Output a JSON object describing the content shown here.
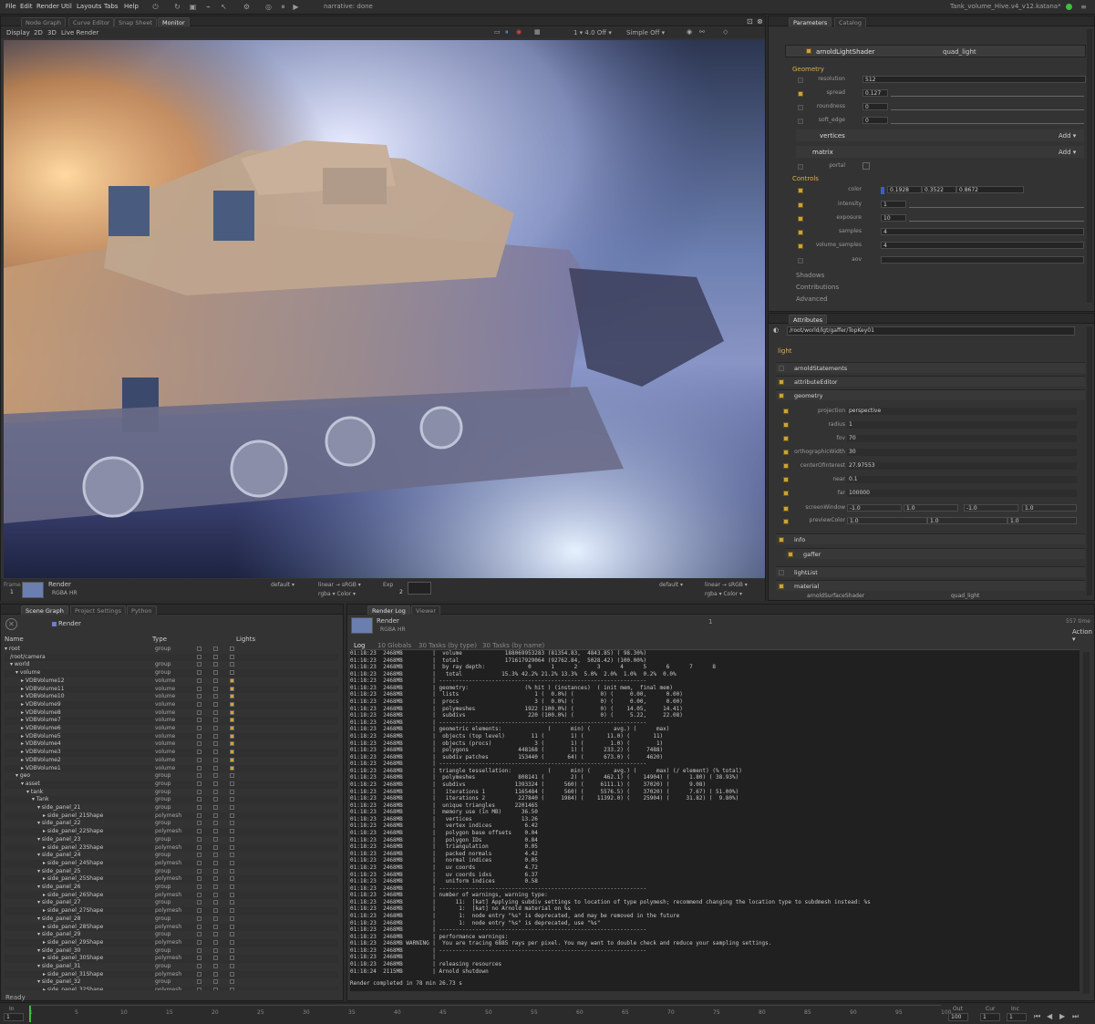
{
  "menu": [
    "File",
    "Edit",
    "Render",
    "Util",
    "Layouts",
    "Tabs",
    "Help"
  ],
  "toolbar": {
    "render_mode": "narrative: done"
  },
  "window_title": "Tank_volume_Hive.v4_v12.katana*",
  "viewer": {
    "tabs": [
      "Node Graph",
      "Curve Editor",
      "Snap Sheet",
      "Monitor"
    ],
    "active_tab": "Monitor",
    "menus": [
      "Display",
      "2D",
      "3D",
      "Live Render"
    ],
    "frame_label": "Frame",
    "frame_value": "1",
    "render_name": "Render",
    "render_sub": "RGBA HR",
    "default_l": "default ▾",
    "linear_srgb_l": "linear → sRGB ▾",
    "rgba_color_l": "rgba ▾ Color ▾",
    "default_r": "default ▾",
    "linear_srgb_r": "linear → sRGB ▾",
    "rgba_color_r": "rgba ▾ Color ▾",
    "fstop": "1 ▾ 4.0 Off ▾",
    "simple": "Simple Off ▾",
    "exposure_label": "Exp",
    "exposure_value": "2"
  },
  "params": {
    "tabs": [
      "Parameters",
      "Catalog"
    ],
    "node_name": "arnoldLightShader",
    "shader": "quad_light",
    "geometry_section": "Geometry",
    "resolution_label": "resolution",
    "resolution": "512",
    "spread_label": "spread",
    "spread": "0.127",
    "roundness_label": "roundness",
    "roundness": "0",
    "soft_edge_label": "soft_edge",
    "soft_edge": "0",
    "vertices": "vertices",
    "matrix": "matrix",
    "add_label": "Add ▾",
    "portal_label": "portal",
    "controls_section": "Controls",
    "color_label": "color",
    "color_r": "0.1928",
    "color_g": "0.3522",
    "color_b": "0.8672",
    "intensity_label": "intensity",
    "intensity": "1",
    "exposure_label": "exposure",
    "exposure": "10",
    "samples_label": "samples",
    "samples": "4",
    "volume_samples_label": "volume_samples",
    "volume_samples": "4",
    "aov_label": "aov",
    "shadows": "Shadows",
    "contributions": "Contributions",
    "advanced": "Advanced",
    "spread_ticks": [
      "0",
      "0.1",
      "0.2",
      "0.3",
      "0.4",
      "0.5",
      "0.6",
      "0.7",
      "0.8",
      "0.9",
      "1"
    ],
    "intensity_ticks": [
      "0",
      "1",
      "10",
      "20",
      "30",
      "40",
      "50",
      "60",
      "70",
      "80",
      "90",
      "100"
    ],
    "exposure_ticks": [
      "0",
      "1",
      "2",
      "3",
      "4",
      "5",
      "6",
      "7",
      "8",
      "9",
      "10",
      "11",
      "12"
    ]
  },
  "attributes": {
    "title": "Attributes",
    "path": "/root/world/lgt/gaffer/TopKey01",
    "light": "light",
    "sections": [
      "arnoldStatements",
      "attributeEditor",
      "geometry"
    ],
    "geometry": [
      {
        "label": "projection",
        "value": "perspective"
      },
      {
        "label": "radius",
        "value": "1"
      },
      {
        "label": "fov",
        "value": "70"
      },
      {
        "label": "orthographicWidth",
        "value": "30"
      },
      {
        "label": "centerOfInterest",
        "value": "27.97553"
      },
      {
        "label": "near",
        "value": "0.1"
      },
      {
        "label": "far",
        "value": "100000"
      }
    ],
    "screenwindow_label": "screenWindow",
    "screenwindow": [
      "-1.0",
      "1.0",
      "-1.0",
      "1.0"
    ],
    "previewcolor_label": "previewColor",
    "previewcolor": [
      "1.0",
      "1.0",
      "1.0"
    ],
    "after": [
      "info",
      "gaffer",
      "lightList",
      "material"
    ],
    "bottom_node": "arnoldSurfaceShader",
    "bottom_value": "quad_light"
  },
  "scenegraph": {
    "tabs": [
      "Scene Graph",
      "Project Settings",
      "Python"
    ],
    "render": "Render",
    "cols": [
      "Name",
      "Type",
      "Lights"
    ],
    "rows": [
      {
        "n": "▾ root",
        "t": "group",
        "d": 0
      },
      {
        "n": "/root/camera",
        "t": "",
        "d": 1
      },
      {
        "n": "▾ world",
        "t": "group",
        "d": 1
      },
      {
        "n": "▾ volume",
        "t": "group",
        "d": 2
      },
      {
        "n": "▸ VDBVolume12",
        "t": "volume",
        "d": 3
      },
      {
        "n": "▸ VDBVolume11",
        "t": "volume",
        "d": 3
      },
      {
        "n": "▸ VDBVolume10",
        "t": "volume",
        "d": 3
      },
      {
        "n": "▸ VDBVolume9",
        "t": "volume",
        "d": 3
      },
      {
        "n": "▸ VDBVolume8",
        "t": "volume",
        "d": 3
      },
      {
        "n": "▸ VDBVolume7",
        "t": "volume",
        "d": 3
      },
      {
        "n": "▸ VDBVolume6",
        "t": "volume",
        "d": 3
      },
      {
        "n": "▸ VDBVolume5",
        "t": "volume",
        "d": 3
      },
      {
        "n": "▸ VDBVolume4",
        "t": "volume",
        "d": 3
      },
      {
        "n": "▸ VDBVolume3",
        "t": "volume",
        "d": 3
      },
      {
        "n": "▸ VDBVolume2",
        "t": "volume",
        "d": 3
      },
      {
        "n": "▸ VDBVolume1",
        "t": "volume",
        "d": 3
      },
      {
        "n": "▾ geo",
        "t": "group",
        "d": 2
      },
      {
        "n": "▾ asset",
        "t": "group",
        "d": 3
      },
      {
        "n": "▾ tank",
        "t": "group",
        "d": 4
      },
      {
        "n": "▾ Tank",
        "t": "group",
        "d": 5
      },
      {
        "n": "▾ side_panel_21",
        "t": "group",
        "d": 6
      },
      {
        "n": "▸ side_panel_21Shape",
        "t": "polymesh",
        "d": 7
      },
      {
        "n": "▾ side_panel_22",
        "t": "group",
        "d": 6
      },
      {
        "n": "▸ side_panel_22Shape",
        "t": "polymesh",
        "d": 7
      },
      {
        "n": "▾ side_panel_23",
        "t": "group",
        "d": 6
      },
      {
        "n": "▸ side_panel_23Shape",
        "t": "polymesh",
        "d": 7
      },
      {
        "n": "▾ side_panel_24",
        "t": "group",
        "d": 6
      },
      {
        "n": "▸ side_panel_24Shape",
        "t": "polymesh",
        "d": 7
      },
      {
        "n": "▾ side_panel_25",
        "t": "group",
        "d": 6
      },
      {
        "n": "▸ side_panel_25Shape",
        "t": "polymesh",
        "d": 7
      },
      {
        "n": "▾ side_panel_26",
        "t": "group",
        "d": 6
      },
      {
        "n": "▸ side_panel_26Shape",
        "t": "polymesh",
        "d": 7
      },
      {
        "n": "▾ side_panel_27",
        "t": "group",
        "d": 6
      },
      {
        "n": "▸ side_panel_27Shape",
        "t": "polymesh",
        "d": 7
      },
      {
        "n": "▾ side_panel_28",
        "t": "group",
        "d": 6
      },
      {
        "n": "▸ side_panel_28Shape",
        "t": "polymesh",
        "d": 7
      },
      {
        "n": "▾ side_panel_29",
        "t": "group",
        "d": 6
      },
      {
        "n": "▸ side_panel_29Shape",
        "t": "polymesh",
        "d": 7
      },
      {
        "n": "▾ side_panel_30",
        "t": "group",
        "d": 6
      },
      {
        "n": "▸ side_panel_30Shape",
        "t": "polymesh",
        "d": 7
      },
      {
        "n": "▾ side_panel_31",
        "t": "group",
        "d": 6
      },
      {
        "n": "▸ side_panel_31Shape",
        "t": "polymesh",
        "d": 7
      },
      {
        "n": "▾ side_panel_32",
        "t": "group",
        "d": 6
      },
      {
        "n": "▸ side_panel_32Shape",
        "t": "polymesh",
        "d": 7
      }
    ],
    "status": "Ready"
  },
  "renderlog": {
    "tabs": [
      "Render Log",
      "Viewer"
    ],
    "render": "Render",
    "render_sub": "RGBA HR",
    "frame": "1",
    "ram": "557 time",
    "action": "Action ▾",
    "subtabs": [
      "Log",
      "10 Globals",
      "30 Tasks (by type)",
      "30 Tasks (by name)"
    ],
    "lines": [
      "01:18:23  2468MB         |  volume             188069953283 (81354.83,  4843.85) ( 98.30%)",
      "01:18:23  2468MB         |  total              171617929064 (92762.84,  5028.42) (100.00%)",
      "01:18:23  2468MB         |  by ray depth:             0      1      2      3      4      5      6      7      8",
      "01:18:23  2468MB         |   total            15.3% 42.2% 21.2% 13.3%  5.0%  2.0%  1.0%  0.2%  0.0%",
      "01:18:23  2468MB         | ---------------------------------------------------------------",
      "01:18:23  2468MB         | geometry:                 (% hit ) (instances)  ( init mem,  final mem)",
      "01:18:23  2468MB         |  lists                       1 (  0.0%) (        0) (     0.00,      0.00)",
      "01:18:23  2468MB         |  procs                       3 (  0.0%) (        0) (     0.00,      0.00)",
      "01:18:23  2468MB         |  polymeshes               1922 (100.0%) (        0) (    14.05,     14.41)",
      "01:18:23  2468MB         |  subdivs                   220 (100.0%) (        0) (     5.22,     22.08)",
      "01:18:23  2468MB         | ---------------------------------------------------------------",
      "01:18:23  2468MB         | geometric elements:              (      min) (       avg.) (      max)",
      "01:18:23  2468MB         |  objects (top level)        11 (        1) (       11.0) (       11)",
      "01:18:23  2468MB         |  objects (procs)             3 (        1) (        1.0) (        1)",
      "01:18:23  2468MB         |  polygons               448168 (        1) (      233.2) (     7488)",
      "01:18:23  2468MB         |  subdiv patches         153440 (       64) (      673.0) (     4620)",
      "01:18:23  2468MB         | ---------------------------------------------------------------",
      "01:18:23  2468MB         | triangle tessellation:           (      min) (       avg.) (      max) (/ element) (% total)",
      "01:18:23  2468MB         |  polymeshes             808141 (        2) (      462.1) (    14904) (      1.80) ( 38.93%)",
      "01:18:23  2468MB         |  subdivs               1393324 (      560) (     6111.1) (    37020) (      9.08)",
      "01:18:23  2468MB         |   iterations 1         1165484 (      560) (     5576.5) (    37020) (      7.67) ( 51.00%)",
      "01:18:23  2468MB         |   iterations 2          227840 (     1984) (    11392.0) (    25904) (     31.82) (  9.80%)",
      "01:18:23  2468MB         |  unique triangles      2201465",
      "01:18:23  2468MB         |  memory use (in MB)      36.50",
      "01:18:23  2468MB         |   vertices               13.26",
      "01:18:23  2468MB         |   vertex indices          6.42",
      "01:18:23  2468MB         |   polygon base offsets    0.04",
      "01:18:23  2468MB         |   polygon IDs             0.84",
      "01:18:23  2468MB         |   triangulation           0.05",
      "01:18:23  2468MB         |   packed normals          4.42",
      "01:18:23  2468MB         |   normal indices          0.05",
      "01:18:23  2468MB         |   uv coords               4.72",
      "01:18:23  2468MB         |   uv coords idxs          6.37",
      "01:18:23  2468MB         |   uniform indices         0.58",
      "01:18:23  2468MB         | ---------------------------------------------------------------",
      "01:18:23  2468MB         | number of warnings, warning type:",
      "01:18:23  2468MB         |      11:  [kat] Applying subdiv settings to location of type polymesh; recommend changing the location type to subdmesh instead: %s",
      "01:18:23  2468MB         |       1:  [kat] no Arnold material on %s",
      "01:18:23  2468MB         |       1:  node entry \"%s\" is deprecated, and may be removed in the future",
      "01:18:23  2468MB         |       1:  node entry \"%s\" is deprecated, use \"%s\"",
      "01:18:23  2468MB         | ---------------------------------------------------------------",
      "01:18:23  2468MB         | performance warnings:",
      "01:18:23  2468MB WARNING |  You are tracing 6885 rays per pixel. You may want to double check and reduce your sampling settings.",
      "01:18:23  2468MB         | ---------------------------------------------------------------",
      "01:18:23  2468MB         |",
      "01:18:23  2468MB         | releasing resources",
      "01:18:24  2115MB         | Arnold shutdown"
    ],
    "footer": "Render completed in 78 min 26.73 s"
  },
  "timeline": {
    "in_label": "In",
    "in_value": "1",
    "out_label": "Out",
    "out_value": "100",
    "cur_label": "Cur",
    "cur_value": "1",
    "inc_label": "Inc",
    "inc_value": "1",
    "ticks": [
      "1",
      "5",
      "10",
      "15",
      "20",
      "25",
      "30",
      "35",
      "40",
      "45",
      "50",
      "55",
      "60",
      "65",
      "70",
      "75",
      "80",
      "85",
      "90",
      "95",
      "100"
    ]
  },
  "colors": {
    "accent": "#d4a72c",
    "bg": "#2b2b2b",
    "panel": "#333333",
    "log_bg": "#202020"
  }
}
